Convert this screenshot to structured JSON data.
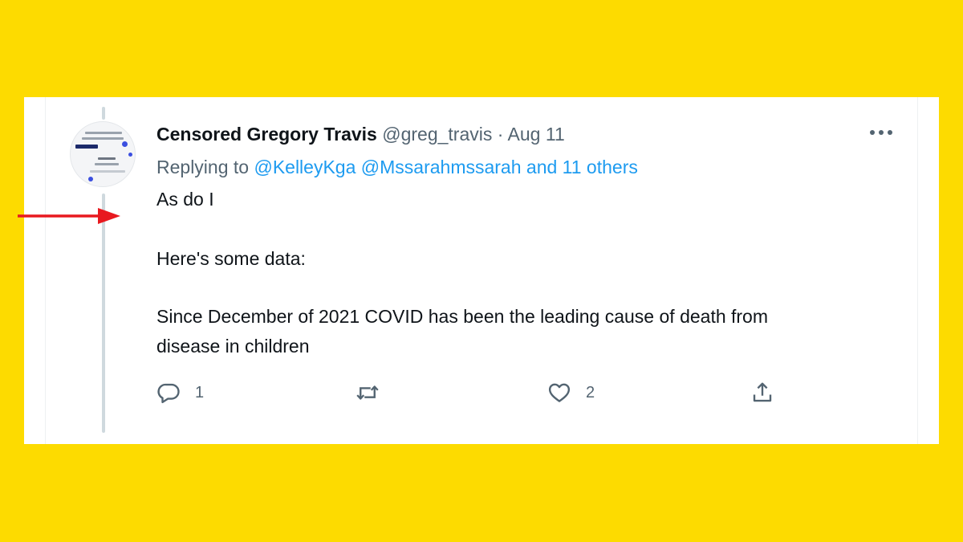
{
  "tweet": {
    "author_name": "Censored Gregory Travis",
    "handle": "@greg_travis",
    "separator": "·",
    "date": "Aug 11",
    "more_icon": "more-horizontal-icon",
    "replying_prefix": "Replying to",
    "replying_users": "@KelleyKga @Mssarahmssarah and 11 others",
    "body": [
      "As do I",
      "Here's some data:",
      "Since December of 2021 COVID has been the leading cause of death from",
      "disease in children"
    ],
    "actions": {
      "reply_count": "1",
      "retweet_count": "",
      "like_count": "2"
    }
  },
  "colors": {
    "background": "#FDDB00",
    "card": "#FFFFFF",
    "link": "#1d9bf0",
    "text": "#0f1419",
    "muted": "#536471",
    "arrow": "#E8191F"
  }
}
